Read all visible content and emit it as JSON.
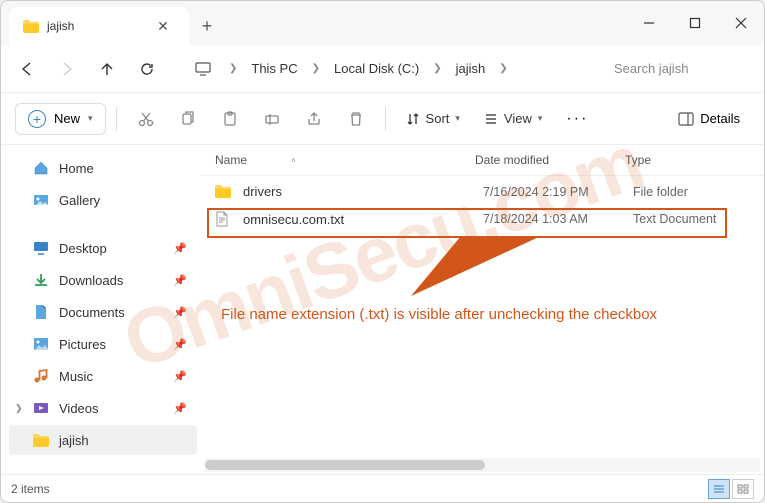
{
  "tab": {
    "title": "jajish"
  },
  "breadcrumbs": [
    "This PC",
    "Local Disk (C:)",
    "jajish"
  ],
  "search": {
    "placeholder": "Search jajish"
  },
  "toolbar": {
    "new_label": "New",
    "sort_label": "Sort",
    "view_label": "View",
    "details_label": "Details"
  },
  "sidebar": {
    "top": [
      {
        "label": "Home",
        "icon": "home"
      },
      {
        "label": "Gallery",
        "icon": "gallery"
      }
    ],
    "pinned": [
      {
        "label": "Desktop",
        "icon": "desktop"
      },
      {
        "label": "Downloads",
        "icon": "downloads"
      },
      {
        "label": "Documents",
        "icon": "documents"
      },
      {
        "label": "Pictures",
        "icon": "pictures"
      },
      {
        "label": "Music",
        "icon": "music"
      },
      {
        "label": "Videos",
        "icon": "videos"
      }
    ],
    "current": {
      "label": "jajish"
    }
  },
  "columns": {
    "name": "Name",
    "date": "Date modified",
    "type": "Type"
  },
  "files": [
    {
      "name": "drivers",
      "date": "7/16/2024 2:19 PM",
      "type": "File folder",
      "icon": "folder"
    },
    {
      "name": "omnisecu.com.txt",
      "date": "7/18/2024 1:03 AM",
      "type": "Text Document",
      "icon": "file"
    }
  ],
  "annotation": "File name extension (.txt) is visible after unchecking the checkbox",
  "watermark": "OmniSecu.com",
  "status": {
    "count": "2 items"
  }
}
